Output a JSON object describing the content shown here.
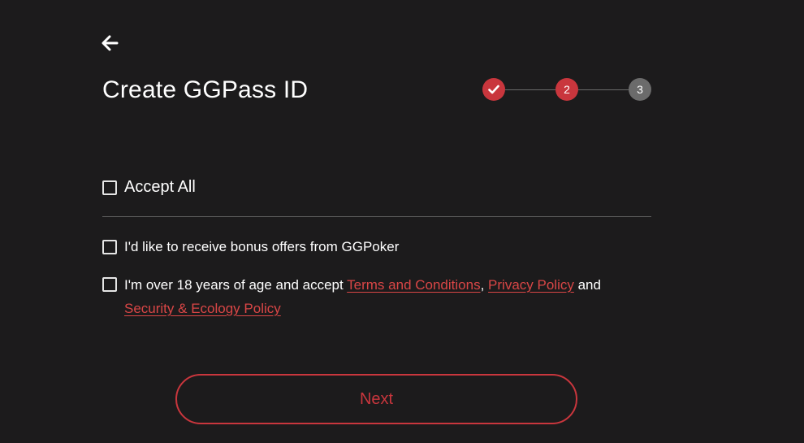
{
  "header": {
    "back_icon": "arrow-left-icon",
    "title": "Create GGPass ID"
  },
  "stepper": {
    "steps": [
      {
        "state": "completed",
        "label": "",
        "icon": "check-icon",
        "color": "#c9363d"
      },
      {
        "state": "active",
        "label": "2",
        "color": "#c9363d"
      },
      {
        "state": "pending",
        "label": "3",
        "color": "#6b6b6b"
      }
    ]
  },
  "form": {
    "accept_all_label": "Accept All",
    "accept_all_checked": false,
    "bonus_label": "I'd like to receive bonus offers from GGPoker",
    "bonus_checked": false,
    "age_prefix": "I'm over 18 years of age and accept ",
    "terms_link": "Terms and Conditions",
    "comma": ",",
    "privacy_link": "Privacy Policy",
    "and_text": " and",
    "security_link": "Security & Ecology Policy",
    "age_checked": false
  },
  "actions": {
    "next_label": "Next"
  },
  "colors": {
    "background": "#1c1b1c",
    "accent": "#c9363d",
    "link": "#d94646",
    "pending": "#6b6b6b"
  }
}
